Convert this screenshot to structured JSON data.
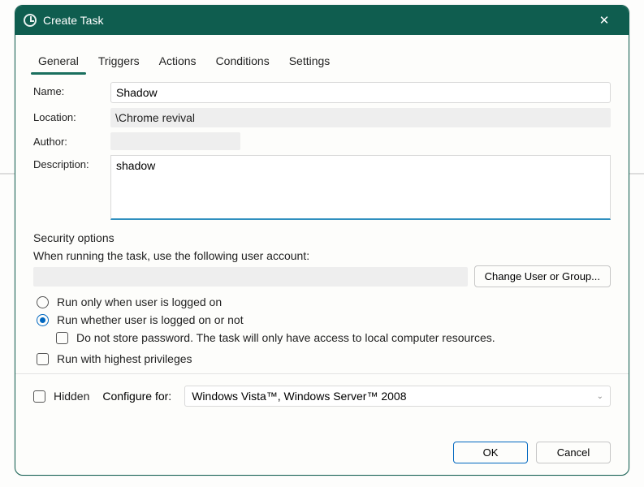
{
  "window": {
    "title": "Create Task",
    "close_icon": "✕"
  },
  "tabs": [
    {
      "label": "General",
      "active": true
    },
    {
      "label": "Triggers",
      "active": false
    },
    {
      "label": "Actions",
      "active": false
    },
    {
      "label": "Conditions",
      "active": false
    },
    {
      "label": "Settings",
      "active": false
    }
  ],
  "general": {
    "labels": {
      "name": "Name:",
      "location": "Location:",
      "author": "Author:",
      "description": "Description:"
    },
    "values": {
      "name": "Shadow",
      "location": "\\Chrome revival",
      "author": "",
      "description": "shadow"
    }
  },
  "security": {
    "heading": "Security options",
    "prompt": "When running the task, use the following user account:",
    "user_account": "",
    "change_btn": "Change User or Group...",
    "radio_logged_on": "Run only when user is logged on",
    "radio_logged_on_or_not": "Run whether user is logged on or not",
    "radio_selected": "logged_on_or_not",
    "do_not_store": "Do not store password.  The task will only have access to local computer resources.",
    "do_not_store_checked": false,
    "highest_priv": "Run with highest privileges",
    "highest_priv_checked": false
  },
  "configure": {
    "hidden_label": "Hidden",
    "hidden_checked": false,
    "label": "Configure for:",
    "value": "Windows Vista™, Windows Server™ 2008"
  },
  "footer": {
    "ok": "OK",
    "cancel": "Cancel"
  }
}
